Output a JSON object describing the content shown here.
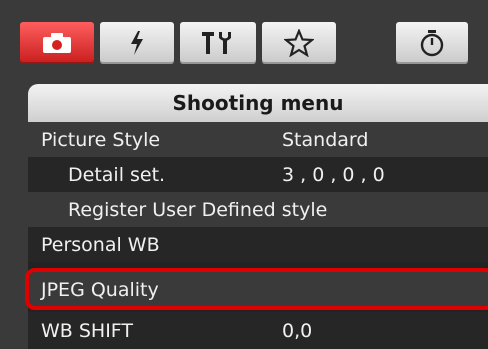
{
  "tabs": [
    {
      "icon": "camera-icon",
      "active": true
    },
    {
      "icon": "flash-icon",
      "active": false
    },
    {
      "icon": "tools-icon",
      "active": false
    },
    {
      "icon": "star-icon",
      "active": false
    },
    {
      "icon": "timer-icon",
      "active": false
    }
  ],
  "menu": {
    "title": "Shooting menu",
    "rows": [
      {
        "label": "Picture Style",
        "value": "Standard"
      },
      {
        "label": "Detail set.",
        "value": "3 , 0 , 0 , 0"
      },
      {
        "label": "Register User Defined style",
        "value": ""
      },
      {
        "label": "Personal WB",
        "value": ""
      },
      {
        "label": "JPEG Quality",
        "value": ""
      },
      {
        "label": "WB SHIFT",
        "value": "0,0"
      }
    ]
  },
  "colors": {
    "active_tab": "#e02a2a",
    "highlight": "#e00000",
    "panel_bg": "#232323"
  }
}
